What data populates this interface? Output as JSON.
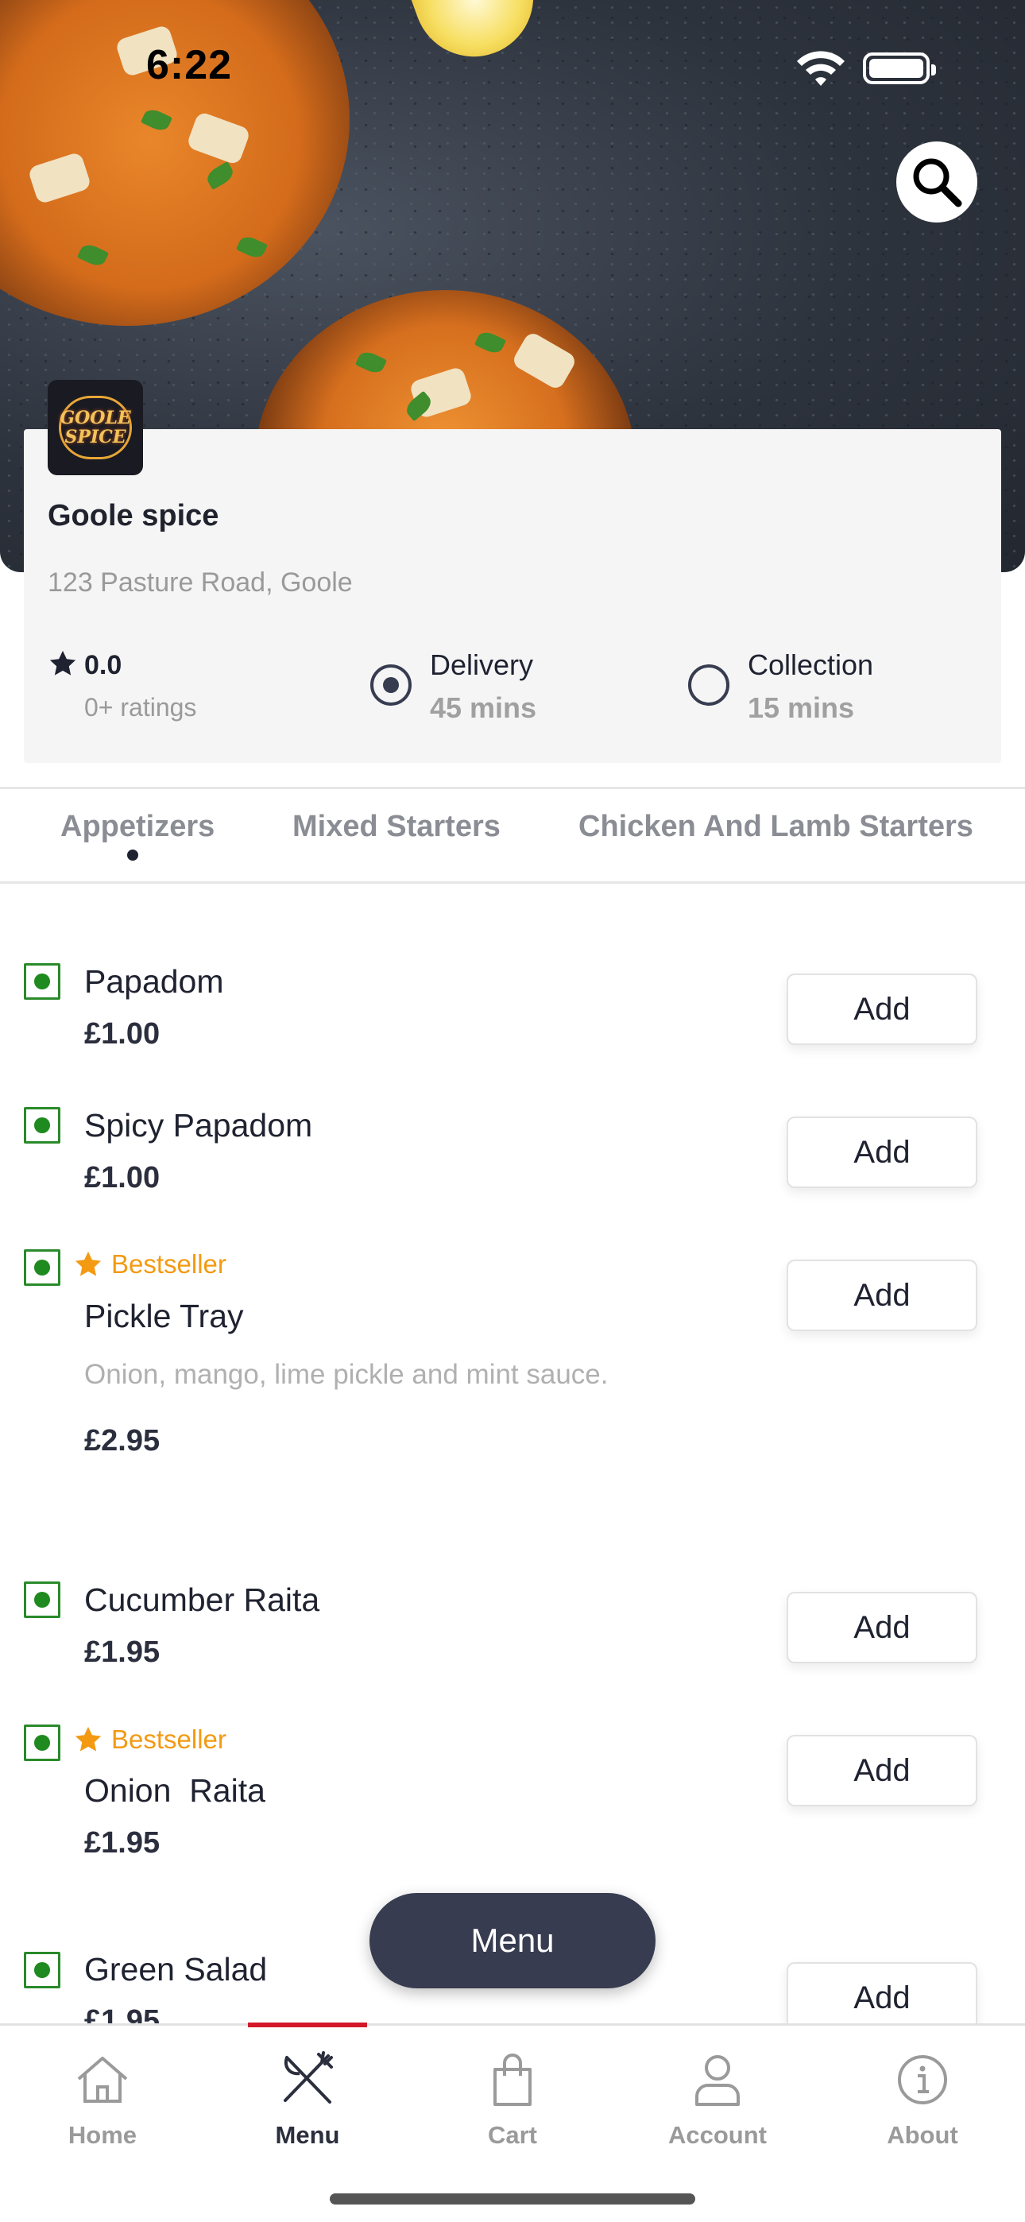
{
  "status_bar": {
    "time": "6:22"
  },
  "restaurant": {
    "logo_text_line1": "GOOLE",
    "logo_text_line2": "SPICE",
    "name": "Goole spice",
    "address": "123 Pasture Road, Goole",
    "rating": "0.0",
    "rating_count": "0+ ratings",
    "delivery": {
      "label": "Delivery",
      "time": "45 mins",
      "selected": true
    },
    "collection": {
      "label": "Collection",
      "time": "15 mins",
      "selected": false
    }
  },
  "tabs": [
    {
      "label": "Appetizers",
      "active": true
    },
    {
      "label": "Mixed Starters",
      "active": false
    },
    {
      "label": "Chicken And Lamb Starters",
      "active": false
    }
  ],
  "menu_items": [
    {
      "name": "Papadom",
      "price": "£1.00",
      "bestseller": false,
      "add_label": "Add"
    },
    {
      "name": "Spicy Papadom",
      "price": "£1.00",
      "bestseller": false,
      "add_label": "Add"
    },
    {
      "name": "Pickle Tray",
      "description": "Onion, mango, lime pickle and mint sauce.",
      "price": "£2.95",
      "bestseller": true,
      "add_label": "Add"
    },
    {
      "name": "Cucumber Raita",
      "price": "£1.95",
      "bestseller": false,
      "add_label": "Add"
    },
    {
      "name": "Onion  Raita",
      "price": "£1.95",
      "bestseller": true,
      "add_label": "Add"
    },
    {
      "name": "Green Salad",
      "price": "£1.95",
      "bestseller": false,
      "add_label": "Add"
    }
  ],
  "bestseller_label": "Bestseller",
  "menu_button_label": "Menu",
  "bottom_nav": [
    {
      "label": "Home",
      "icon": "home-icon",
      "active": false
    },
    {
      "label": "Menu",
      "icon": "fork-knife-icon",
      "active": true
    },
    {
      "label": "Cart",
      "icon": "shopping-bag-icon",
      "active": false
    },
    {
      "label": "Account",
      "icon": "user-icon",
      "active": false
    },
    {
      "label": "About",
      "icon": "info-icon",
      "active": false
    }
  ],
  "colors": {
    "accent": "#383c50",
    "active_tab_bar": "#d3192b",
    "veg_green": "#1f8a1f",
    "bestseller": "#f39a12"
  }
}
